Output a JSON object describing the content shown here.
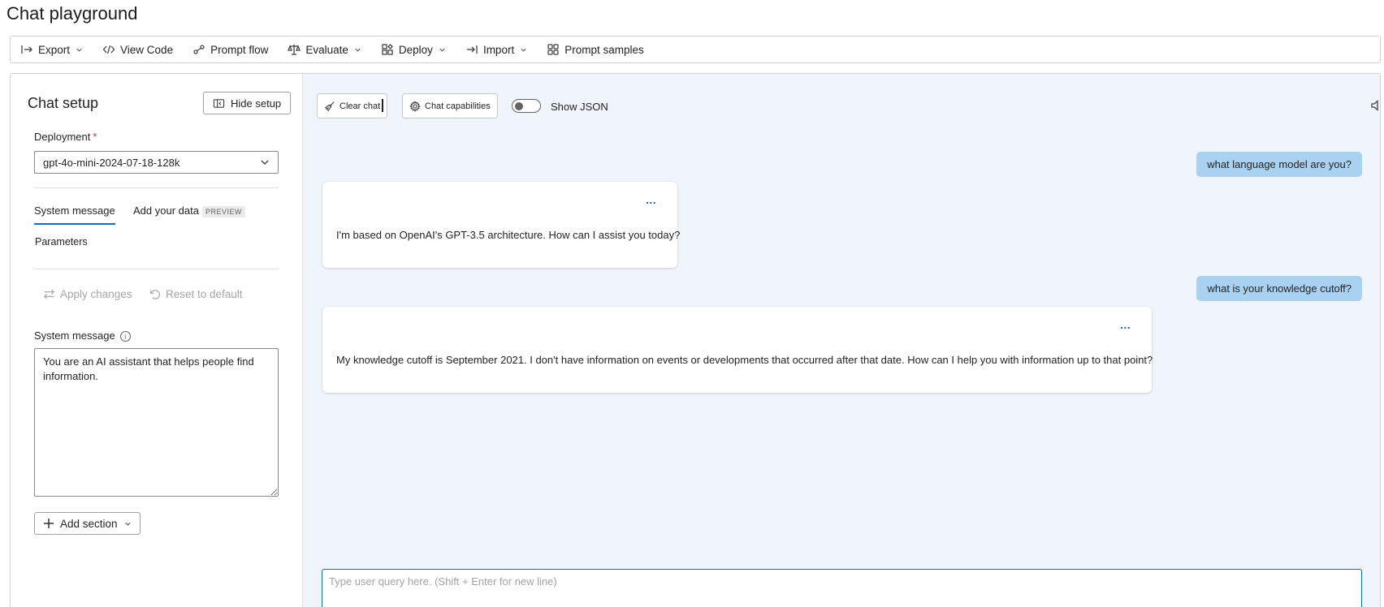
{
  "page": {
    "title": "Chat playground"
  },
  "toolbar": {
    "items": [
      {
        "label": "Export",
        "icon": "export-icon",
        "dropdown": true
      },
      {
        "label": "View Code",
        "icon": "code-icon",
        "dropdown": false
      },
      {
        "label": "Prompt flow",
        "icon": "prompt-flow-icon",
        "dropdown": false
      },
      {
        "label": "Evaluate",
        "icon": "scale-icon",
        "dropdown": true
      },
      {
        "label": "Deploy",
        "icon": "deploy-icon",
        "dropdown": true
      },
      {
        "label": "Import",
        "icon": "import-icon",
        "dropdown": true
      },
      {
        "label": "Prompt samples",
        "icon": "grid-icon",
        "dropdown": false
      }
    ]
  },
  "setup": {
    "title": "Chat setup",
    "hide_label": "Hide setup",
    "deployment_label": "Deployment",
    "required_mark": "*",
    "deployment_value": "gpt-4o-mini-2024-07-18-128k",
    "tabs": {
      "system_message": "System message",
      "add_data": "Add your data",
      "preview_badge": "PREVIEW",
      "parameters": "Parameters"
    },
    "apply_label": "Apply changes",
    "reset_label": "Reset to default",
    "system_message_label": "System message",
    "system_message_value": "You are an AI assistant that helps people find information.",
    "add_section_label": "Add section"
  },
  "chat": {
    "clear_label": "Clear chat",
    "capabilities_label": "Chat capabilities",
    "show_json_label": "Show JSON",
    "messages": [
      {
        "role": "user",
        "text": "what language model are you?"
      },
      {
        "role": "assistant",
        "text": "I'm based on OpenAI's GPT-3.5 architecture. How can I assist you today?"
      },
      {
        "role": "user",
        "text": "what is your knowledge cutoff?"
      },
      {
        "role": "assistant",
        "text": "My knowledge cutoff is September 2021. I don't have information on events or developments that occurred after that date. How can I help you with information up to that point?"
      }
    ],
    "more_label": "...",
    "input_placeholder": "Type user query here. (Shift + Enter for new line)"
  },
  "colors": {
    "accent": "#0f6cbd",
    "user_bubble": "#a9d1f0",
    "chat_background": "#f0f5fc",
    "required": "#c4314b"
  }
}
